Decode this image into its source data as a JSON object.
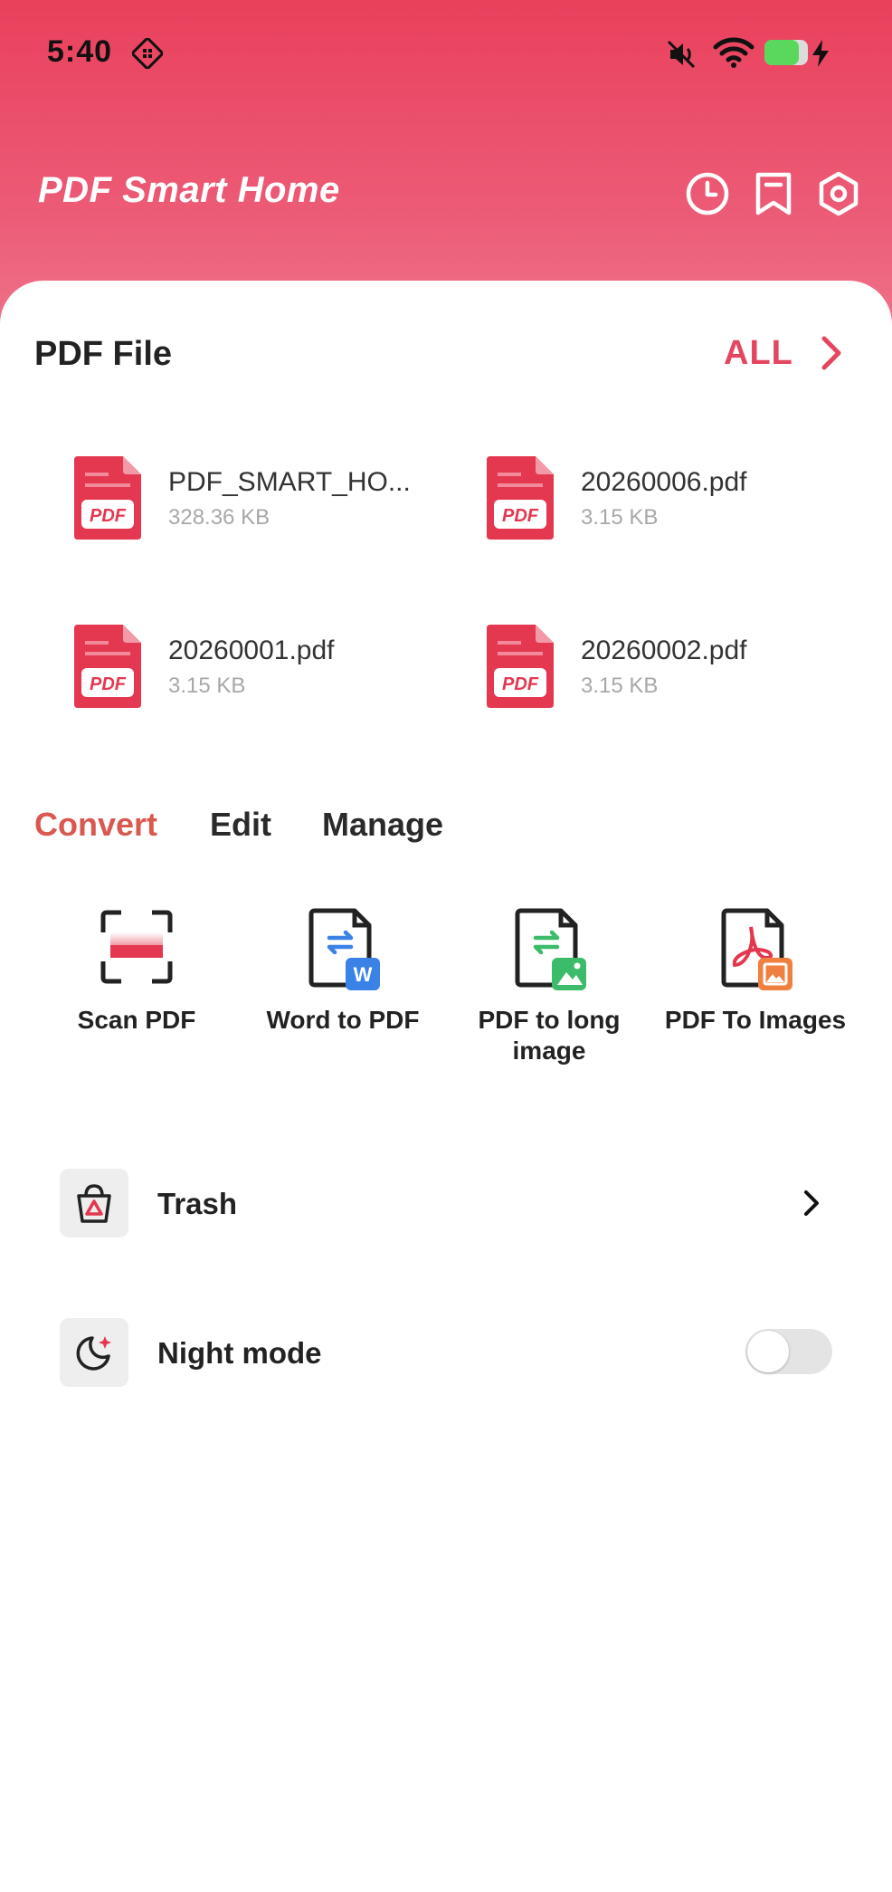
{
  "status_bar": {
    "time": "5:40",
    "battery_level": 0.8
  },
  "header": {
    "title": "PDF Smart Home",
    "icons": [
      "history-icon",
      "bookmark-icon",
      "settings-icon"
    ]
  },
  "files_section": {
    "title": "PDF File",
    "all_label": "ALL",
    "files": [
      {
        "name": "PDF_SMART_HO...",
        "size": "328.36 KB"
      },
      {
        "name": "20260006.pdf",
        "size": "3.15 KB"
      },
      {
        "name": "20260001.pdf",
        "size": "3.15 KB"
      },
      {
        "name": "20260002.pdf",
        "size": "3.15 KB"
      }
    ],
    "file_badge": "PDF"
  },
  "tabs": [
    {
      "label": "Convert",
      "active": true
    },
    {
      "label": "Edit",
      "active": false
    },
    {
      "label": "Manage",
      "active": false
    }
  ],
  "tools": [
    {
      "label": "Scan PDF",
      "icon": "scan-icon"
    },
    {
      "label": "Word to PDF",
      "icon": "word-to-pdf-icon"
    },
    {
      "label": "PDF to long image",
      "icon": "pdf-to-long-image-icon"
    },
    {
      "label": "PDF To Images",
      "icon": "pdf-to-images-icon"
    }
  ],
  "settings_rows": {
    "trash": {
      "label": "Trash",
      "icon": "trash-icon"
    },
    "night_mode": {
      "label": "Night mode",
      "icon": "moon-icon",
      "enabled": false
    }
  },
  "colors": {
    "brand": "#e9405c",
    "active_tab": "#d9584f",
    "all_link": "#e4465f",
    "pdf_red": "#e3384f"
  }
}
